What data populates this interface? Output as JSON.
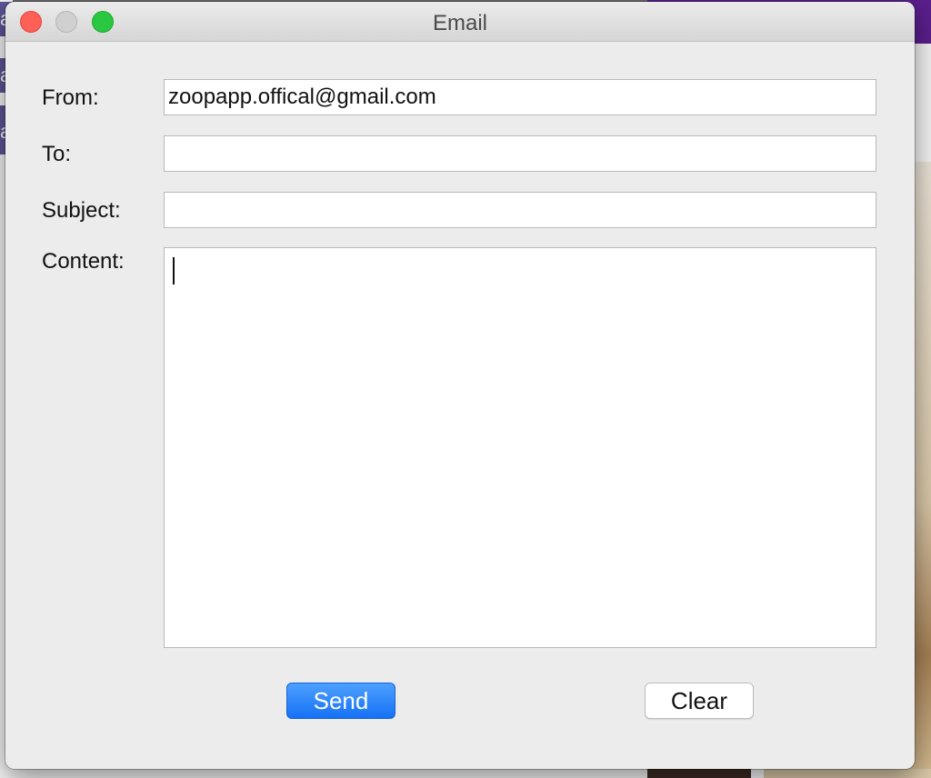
{
  "window": {
    "title": "Email"
  },
  "form": {
    "from_label": "From:",
    "from_value": "zoopapp.offical@gmail.com",
    "to_label": "To:",
    "to_value": "",
    "subject_label": "Subject:",
    "subject_value": "",
    "content_label": "Content:",
    "content_value": ""
  },
  "buttons": {
    "send_label": "Send",
    "clear_label": "Clear"
  },
  "colors": {
    "send_button": "#1671f5",
    "close_button": "#fe5f57",
    "zoom_button": "#2ac840"
  }
}
